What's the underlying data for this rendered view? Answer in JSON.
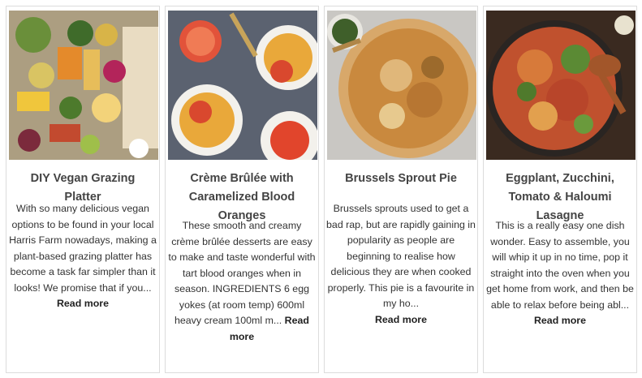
{
  "cards": [
    {
      "title": "DIY Vegan Grazing Platter",
      "image_icon": "grazing-platter-photo",
      "excerpt": "With so many delicious vegan options to be found in your local Harris Farm nowadays, making a plant-based grazing platter has become a task far simpler than it looks! We promise that if you...",
      "read_more": "Read more"
    },
    {
      "title": "Crème Brûlée with Caramelized Blood Oranges",
      "image_icon": "creme-brulee-photo",
      "excerpt": "These smooth and creamy crème brûlée desserts are easy to make and taste wonderful with tart blood oranges when in season. INGREDIENTS 6 egg yokes (at room temp) 600ml heavy cream 100ml m...",
      "read_more": "Read more"
    },
    {
      "title": "Brussels Sprout Pie",
      "image_icon": "brussels-sprout-pie-photo",
      "excerpt": "Brussels sprouts used to get a bad rap, but are rapidly gaining in popularity as people are beginning to realise how delicious they are when cooked properly. This pie is a favourite in my ho...",
      "read_more": "Read more"
    },
    {
      "title": "Eggplant, Zucchini, Tomato & Haloumi Lasagne",
      "image_icon": "lasagne-photo",
      "excerpt": "This is a really easy one dish wonder. Easy to assemble, you will whip it up in no time, pop it straight into the oven when you get home from work, and then be able to relax before being abl...",
      "read_more": "Read more"
    }
  ]
}
